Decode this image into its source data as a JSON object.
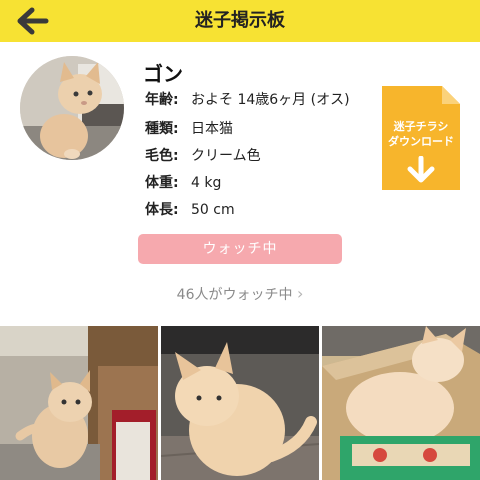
{
  "header": {
    "title": "迷子掲示板",
    "back_icon": "arrow-left-icon",
    "bg_color": "#f7e233"
  },
  "cat": {
    "name": "ゴン",
    "details": [
      {
        "label": "年齢:",
        "value": "およそ 14歳6ヶ月 (オス)"
      },
      {
        "label": "種類:",
        "value": "日本猫"
      },
      {
        "label": "毛色:",
        "value": "クリーム色"
      },
      {
        "label": "体重:",
        "value": "4 kg"
      },
      {
        "label": "体長:",
        "value": "50 cm"
      }
    ]
  },
  "flyer": {
    "line1": "迷子チラシ",
    "line2": "ダウンロード",
    "icon": "download-arrow-icon",
    "color": "#f7b52c"
  },
  "watch": {
    "button_label": "ウォッチ中",
    "button_color": "#f6a9ae",
    "count_text": "46人がウォッチ中",
    "chevron": "›"
  },
  "photos": [
    "cat-photo-1",
    "cat-photo-2",
    "cat-photo-3"
  ]
}
